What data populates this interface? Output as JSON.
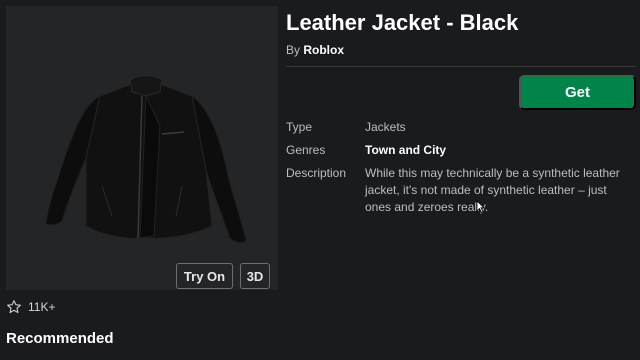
{
  "item": {
    "title": "Leather Jacket - Black",
    "by_prefix": "By",
    "creator": "Roblox",
    "get_label": "Get",
    "details": {
      "type_label": "Type",
      "type_value": "Jackets",
      "genres_label": "Genres",
      "genres_value": "Town and City",
      "description_label": "Description",
      "description_value": "While this may technically be a synthetic leather jacket, it's not made of synthetic leather – just ones and zeroes really."
    }
  },
  "preview": {
    "try_on_label": "Try On",
    "three_d_label": "3D"
  },
  "favorites": {
    "count": "11K+",
    "icon": "star-outline-icon"
  },
  "recommended": {
    "heading": "Recommended"
  },
  "colors": {
    "background": "#191b1d",
    "panel": "#232527",
    "get_button": "#00844a",
    "muted_text": "#bdbebe"
  }
}
